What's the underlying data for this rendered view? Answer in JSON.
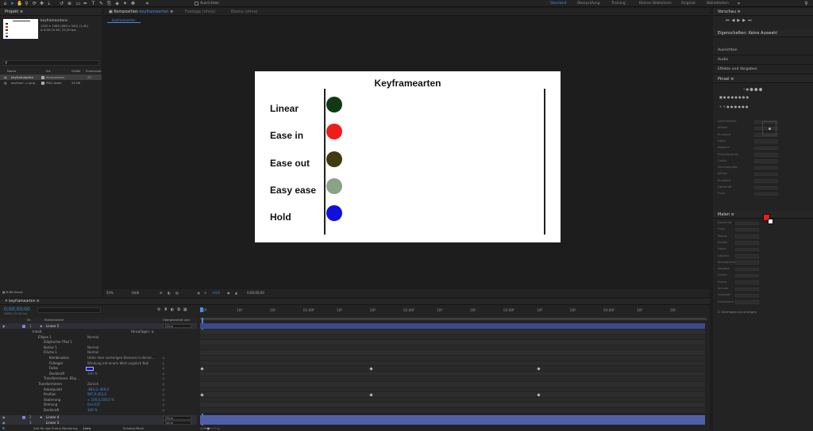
{
  "toolbar": {
    "align_label": "Ausrichten",
    "workspaces": [
      "Standard",
      "Überprüfung",
      "Training",
      "Kleiner Bildschirm",
      "Original",
      "Bibliotheken"
    ],
    "active_workspace": "Standard"
  },
  "project": {
    "title": "Projekt",
    "comp_name": "keyframeartenv",
    "comp_info": [
      "1920 x 1080 (960 x 540) (1,00)",
      "Δ 0;00;10;00, 25,00 fps"
    ],
    "search_placeholder": "",
    "columns": {
      "name": "Name",
      "type": "Art",
      "size": "Größe",
      "fps": "Framerate"
    },
    "items": [
      {
        "name": "keyframearten",
        "type": "Komposition",
        "size": "",
        "fps": "25"
      },
      {
        "name": "keyfram...n.png",
        "type": "PNG-Datei",
        "size": "29 KB",
        "fps": ""
      }
    ],
    "bit_depth": "8-Bit-Kanal"
  },
  "composition": {
    "tab_label": "Komposition",
    "tab_name": "keyframearten",
    "footage_tab": "Footage (ohne)",
    "layer_tab": "Ebene (ohne)",
    "sub_tab": "keyframearten",
    "zoom": "50%",
    "quality": "Halb",
    "offset": "+0,0",
    "timecode": "0;00;00;00"
  },
  "canvas": {
    "title": "Keyframearten",
    "rows": [
      {
        "label": "Linear",
        "color": "#0f3a12"
      },
      {
        "label": "Ease in",
        "color": "#ee1c1c"
      },
      {
        "label": "Ease out",
        "color": "#403a10"
      },
      {
        "label": "Easy ease",
        "color": "#8aa286"
      },
      {
        "label": "Hold",
        "color": "#1010dd"
      }
    ]
  },
  "right": {
    "preview_title": "Vorschau",
    "props_title": "Eigenschaften: Keine Auswahl",
    "sections": [
      "Ausrichten",
      "Audio",
      "Effekte und Vorgaben"
    ],
    "brush_title": "Pinsel",
    "paint_title": "Malen",
    "brush_labels": [
      "Durchmesser",
      "Winkel",
      "Rundheit",
      "Härte",
      "Abstand",
      "Pinseldynamik",
      "Größe",
      "Minimalgröße",
      "Winkel",
      "Rundheit",
      "Deckkraft",
      "Fluss"
    ],
    "paint_labels": [
      "Deckkraft",
      "Fluss",
      "Modus",
      "Kanäle",
      "Dauer",
      "Löschen",
      "Klonoptionen",
      "Vorgabe",
      "Quelle",
      "Ebene",
      "Versatz",
      "Quellzeit",
      "Quellebene"
    ],
    "checkbox_label": "Überlagerung anzeigen",
    "paint_values": {
      "opacity": "100 %",
      "flow": "100 %",
      "mode": "Normal",
      "channels": "RGBA",
      "duration": "Konstant"
    },
    "fg_color": "#ee1c1c",
    "bg_color": "#ffffff"
  },
  "timeline": {
    "tab_label": "keyframearten",
    "timecode": "0;00;00;00",
    "fps_note": "00000 (25,00 fps)",
    "columns": {
      "nr": "Nr.",
      "name": "Ebenenname",
      "parent": "Übergeordnet und verk..."
    },
    "ticks": [
      "0f",
      "10f",
      "20f",
      "01:00f",
      "10f",
      "20f",
      "02:00f",
      "10f",
      "20f",
      "03:00f",
      "10f",
      "20f",
      "04:00f",
      "10f",
      "20f"
    ],
    "layers": [
      {
        "nr": "1",
        "name": "Linear 5",
        "parent": "Ohne"
      },
      {
        "nr": "2",
        "name": "Linear 4",
        "parent": "Ohne"
      },
      {
        "nr": "3",
        "name": "Linear 3",
        "parent": "Ohne"
      }
    ],
    "props": [
      {
        "indent": 1,
        "label": "Inhalt",
        "value": "",
        "extra": "Hinzufügen: ⊕"
      },
      {
        "indent": 2,
        "label": "Ellipse 1",
        "value": "Normal",
        "extra": ""
      },
      {
        "indent": 3,
        "label": "Elliptischer Pfad 1",
        "value": "",
        "extra": ""
      },
      {
        "indent": 3,
        "label": "Kontur 1",
        "value": "Normal",
        "extra": ""
      },
      {
        "indent": 3,
        "label": "Fläche 1",
        "value": "Normal",
        "extra": ""
      },
      {
        "indent": 4,
        "label": "Kombination",
        "value": "Unter dem vorherigen Element in dersel...",
        "extra": ""
      },
      {
        "indent": 4,
        "label": "Füllregel",
        "value": "Windung mit einem Wert ungleich Null",
        "extra": ""
      },
      {
        "indent": 4,
        "label": "Farbe",
        "value": "",
        "extra": ""
      },
      {
        "indent": 4,
        "label": "Deckkraft",
        "value": "100 %",
        "extra": ""
      },
      {
        "indent": 3,
        "label": "Transformieren: Ellip...",
        "value": "",
        "extra": ""
      },
      {
        "indent": 2,
        "label": "Transformieren",
        "value": "Zurück",
        "extra": ""
      },
      {
        "indent": 3,
        "label": "Ankerpunkt",
        "value": "-883,0,-460,0",
        "extra": ""
      },
      {
        "indent": 3,
        "label": "Position",
        "value": "997,0,451,0",
        "extra": ""
      },
      {
        "indent": 3,
        "label": "Skalierung",
        "value": "∞ 100,0,100,0 %",
        "extra": ""
      },
      {
        "indent": 3,
        "label": "Drehung",
        "value": "0x+0,0°",
        "extra": ""
      },
      {
        "indent": 3,
        "label": "Deckkraft",
        "value": "100 %",
        "extra": ""
      }
    ],
    "footer_label": "Zeit für das Frame-Rendering",
    "footer_ms": "14ms",
    "footer_mode": "Schalter/Modi"
  }
}
